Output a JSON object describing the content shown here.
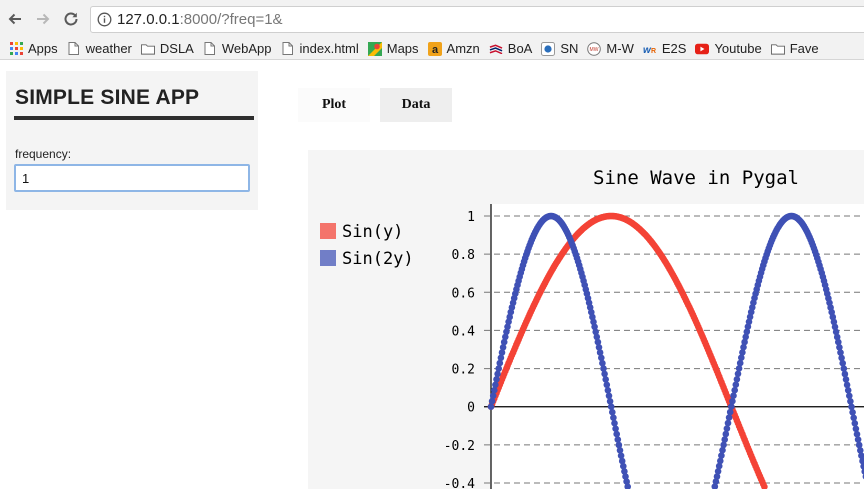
{
  "browser": {
    "url_host": "127.0.0.1",
    "url_rest": ":8000/?freq=1&",
    "bookmarks": [
      {
        "label": "Apps",
        "icon": "apps-grid-icon"
      },
      {
        "label": "weather",
        "icon": "page-icon"
      },
      {
        "label": "DSLA",
        "icon": "folder-icon"
      },
      {
        "label": "WebApp",
        "icon": "page-icon"
      },
      {
        "label": "index.html",
        "icon": "page-icon"
      },
      {
        "label": "Maps",
        "icon": "maps-icon"
      },
      {
        "label": "Amzn",
        "icon": "amazon-icon"
      },
      {
        "label": "BoA",
        "icon": "boa-icon"
      },
      {
        "label": "SN",
        "icon": "sn-icon"
      },
      {
        "label": "M-W",
        "icon": "merriam-webster-icon"
      },
      {
        "label": "E2S",
        "icon": "e2s-icon"
      },
      {
        "label": "Youtube",
        "icon": "youtube-icon"
      },
      {
        "label": "Fave",
        "icon": "folder-icon"
      }
    ]
  },
  "sidebar": {
    "title": "SIMPLE SINE APP",
    "frequency_label": "frequency:",
    "frequency_value": "1"
  },
  "tabs": [
    {
      "label": "Plot",
      "active": true
    },
    {
      "label": "Data",
      "active": false
    }
  ],
  "chart_data": {
    "type": "line",
    "title": "Sine Wave in Pygal",
    "legend_position": "left",
    "grid": true,
    "yticks": [
      "1",
      "0.8",
      "0.6",
      "0.4",
      "0.2",
      "0",
      "-0.2",
      "-0.4"
    ],
    "ylim": [
      -0.4,
      1
    ],
    "x_min": 0,
    "x_max_visible": 4.9,
    "series": [
      {
        "name": "Sin(y)",
        "color": "#f44336",
        "function": "sin(x)"
      },
      {
        "name": "Sin(2y)",
        "color": "#3f51b5",
        "function": "sin(2x)"
      }
    ]
  }
}
